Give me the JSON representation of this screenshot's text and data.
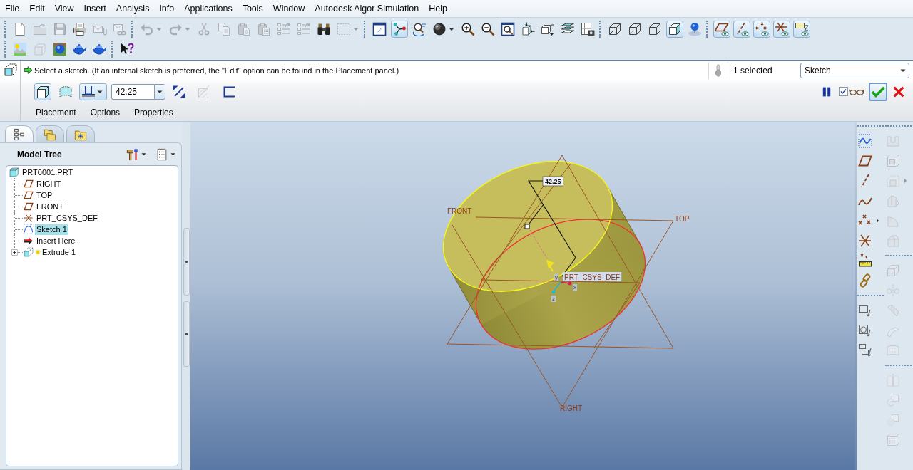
{
  "menu_bar": {
    "items": [
      "File",
      "Edit",
      "View",
      "Insert",
      "Analysis",
      "Info",
      "Applications",
      "Tools",
      "Window",
      "Autodesk Algor Simulation",
      "Help"
    ]
  },
  "toolbar": {
    "rows": [
      [
        [
          {
            "pressed": false,
            "disabled": false
          },
          {
            "pressed": false,
            "disabled": true
          },
          {
            "pressed": false,
            "disabled": true
          },
          {
            "pressed": false,
            "disabled": false
          },
          {
            "pressed": false,
            "disabled": true
          },
          {
            "pressed": false,
            "disabled": true
          }
        ],
        [
          {
            "pressed": false,
            "disabled": true
          },
          {
            "pressed": false,
            "disabled": true
          },
          {
            "pressed": false,
            "disabled": true
          },
          {
            "pressed": false,
            "disabled": true
          },
          {
            "pressed": false,
            "disabled": true
          },
          {
            "pressed": false,
            "disabled": true
          },
          {
            "pressed": false,
            "disabled": true
          },
          {
            "pressed": false,
            "disabled": true
          },
          {
            "pressed": false,
            "disabled": false
          },
          {
            "pressed": false,
            "disabled": true
          }
        ],
        [
          {
            "pressed": false,
            "disabled": false
          },
          {
            "pressed": true,
            "disabled": false
          },
          {
            "pressed": false,
            "disabled": false
          },
          {
            "pressed": false,
            "disabled": false
          },
          {
            "pressed": false,
            "disabled": false
          },
          {
            "pressed": false,
            "disabled": false
          },
          {
            "pressed": false,
            "disabled": false
          },
          {
            "pressed": false,
            "disabled": false
          },
          {
            "pressed": false,
            "disabled": false
          },
          {
            "pressed": false,
            "disabled": false
          },
          {
            "pressed": false,
            "disabled": false
          }
        ],
        [
          {
            "pressed": false,
            "disabled": false
          },
          {
            "pressed": false,
            "disabled": false
          },
          {
            "pressed": false,
            "disabled": false
          },
          {
            "pressed": true,
            "disabled": false
          },
          {
            "pressed": false,
            "disabled": false
          }
        ],
        [
          {
            "pressed": true,
            "disabled": false
          },
          {
            "pressed": true,
            "disabled": false
          },
          {
            "pressed": true,
            "disabled": false
          },
          {
            "pressed": true,
            "disabled": false
          },
          {
            "pressed": true,
            "disabled": false
          }
        ]
      ],
      [
        [
          {
            "pressed": false,
            "disabled": false
          },
          {
            "pressed": false,
            "disabled": true
          },
          {
            "pressed": false,
            "disabled": false
          },
          {
            "pressed": false,
            "disabled": false
          },
          {
            "pressed": false,
            "disabled": false
          }
        ],
        [
          {
            "pressed": false,
            "disabled": false
          }
        ]
      ]
    ]
  },
  "dashboard": {
    "message": "Select a sketch. (If an internal sketch is preferred, the \"Edit\" option can be found in the Placement panel.)",
    "selection_count": "1 selected",
    "filter": {
      "value": "Sketch"
    },
    "type_buttons": [
      {
        "selected": true
      },
      {
        "selected": false
      }
    ],
    "depth_option": {
      "pressed": true
    },
    "depth": {
      "value": "42.25"
    },
    "tool_buttons": [
      {
        "disabled": false
      },
      {
        "disabled": true
      },
      {
        "disabled": false
      }
    ],
    "preview": {
      "checked": true
    },
    "panels": [
      {
        "label": "Placement",
        "selected": false
      },
      {
        "label": "Options",
        "selected": false
      },
      {
        "label": "Properties",
        "selected": false
      }
    ]
  },
  "navigator": {
    "tabs": [
      {
        "selected": true
      },
      {
        "selected": false
      },
      {
        "selected": false
      }
    ],
    "title": "Model Tree",
    "tree": {
      "label": "PRT0001.PRT",
      "kind": "part",
      "selected": false,
      "children": [
        {
          "label": "RIGHT",
          "kind": "plane",
          "selected": false,
          "collapsed": false,
          "in_progress": false
        },
        {
          "label": "TOP",
          "kind": "plane",
          "selected": false,
          "collapsed": false,
          "in_progress": false
        },
        {
          "label": "FRONT",
          "kind": "plane",
          "selected": false,
          "collapsed": false,
          "in_progress": false
        },
        {
          "label": "PRT_CSYS_DEF",
          "kind": "csys",
          "selected": false,
          "collapsed": false,
          "in_progress": false
        },
        {
          "label": "Sketch 1",
          "kind": "sketch",
          "selected": true,
          "collapsed": false,
          "in_progress": false
        },
        {
          "label": "Insert Here",
          "kind": "insert",
          "selected": false,
          "collapsed": false,
          "in_progress": false
        },
        {
          "label": "Extrude 1",
          "kind": "extrude",
          "selected": false,
          "collapsed": true,
          "in_progress": true
        }
      ]
    }
  },
  "viewport": {
    "datum_labels": [
      "FRONT",
      "TOP",
      "RIGHT"
    ],
    "csys_label": "PRT_CSYS_DEF",
    "axis_labels": [
      "y",
      "x",
      "z"
    ],
    "dimension": "42.25"
  },
  "feature_toolbar": {
    "columns": [
      [
        [
          {
            "disabled": false
          },
          {
            "disabled": false
          },
          {
            "disabled": false
          },
          {
            "disabled": false
          },
          {
            "disabled": false
          },
          {
            "disabled": false
          },
          {
            "disabled": false
          },
          {
            "disabled": false
          }
        ],
        [
          {
            "disabled": false
          },
          {
            "disabled": false
          },
          {
            "disabled": false
          }
        ]
      ],
      [
        [
          {
            "disabled": true
          },
          {
            "disabled": true
          },
          {
            "disabled": true
          },
          {
            "disabled": true
          },
          {
            "disabled": true
          },
          {
            "disabled": true
          }
        ],
        [
          {
            "disabled": true
          },
          {
            "disabled": true
          },
          {
            "disabled": true
          },
          {
            "disabled": true
          },
          {
            "disabled": true
          }
        ],
        [
          {
            "disabled": true
          },
          {
            "disabled": true
          },
          {
            "disabled": true
          },
          {
            "disabled": true
          }
        ]
      ]
    ]
  }
}
